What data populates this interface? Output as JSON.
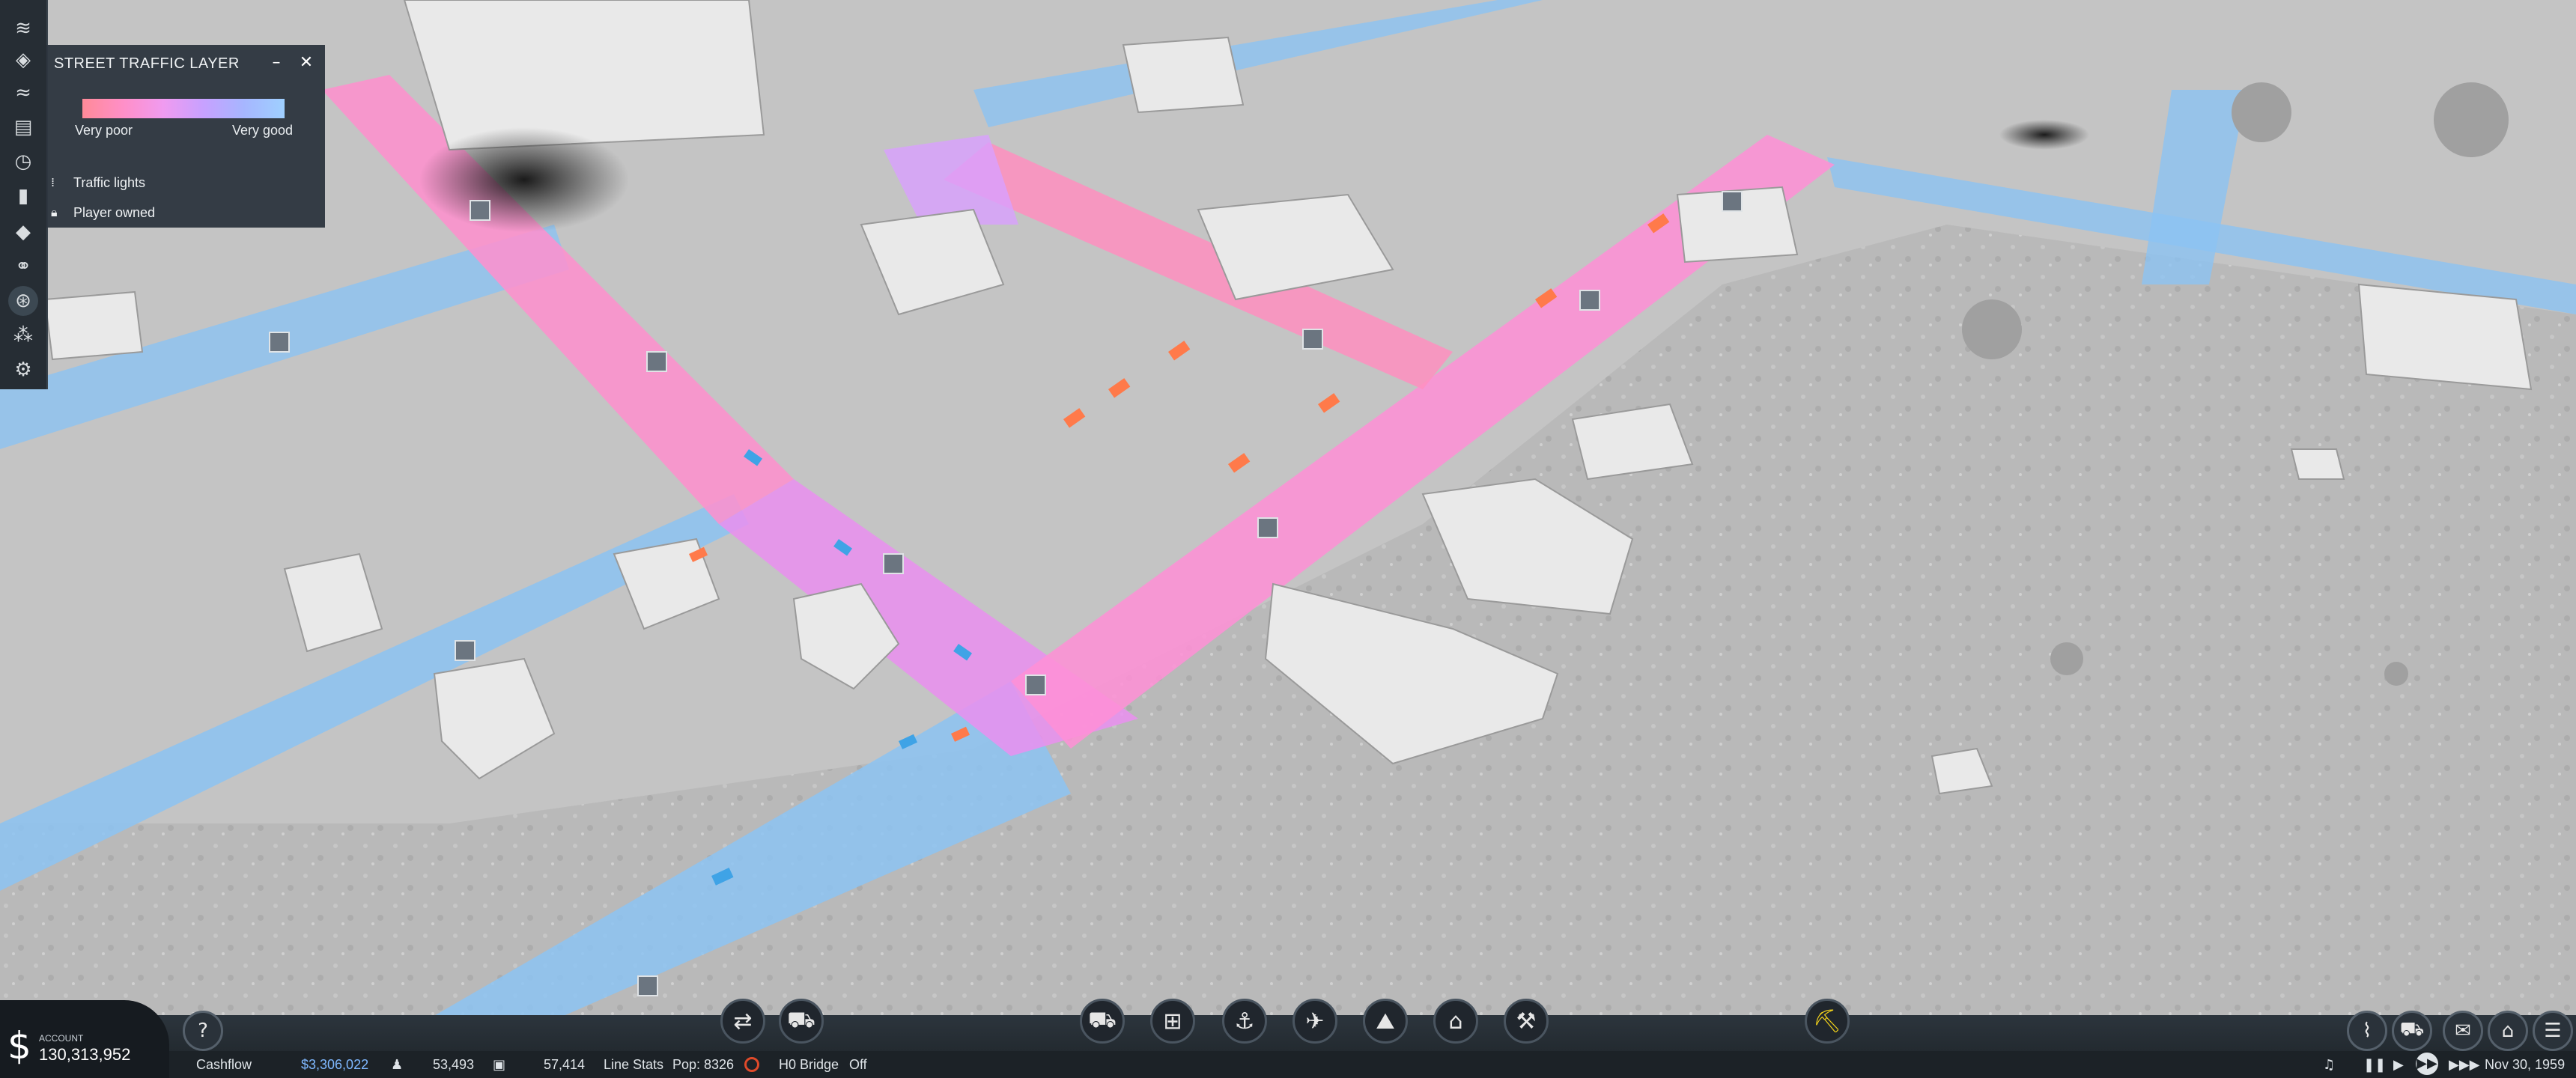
{
  "colors": {
    "very_poor": "#ff8a98",
    "very_good": "#9fd0ff",
    "panel_bg": "#2e363f",
    "cashflow_positive": "#7fb8ff"
  },
  "traffic_panel": {
    "title": "STREET TRAFFIC LAYER",
    "minimize_icon": "minimize-icon",
    "close_icon": "close-icon",
    "legend_low": "Very poor",
    "legend_high": "Very good",
    "rows": [
      {
        "label": "Traffic lights",
        "icon": "traffic-light-icon"
      },
      {
        "label": "Player owned",
        "icon": "lock-icon"
      }
    ]
  },
  "left_toolbar": {
    "icons": [
      "layers-icon",
      "terrain-icon",
      "water-icon",
      "newspaper-icon",
      "clock-icon",
      "stats-icon",
      "cube-icon",
      "network-icon",
      "traffic-layer-icon",
      "signal-icon",
      "settings-icon"
    ]
  },
  "account": {
    "label": "ACCOUNT",
    "value": "130,313,952",
    "currency_symbol": "$"
  },
  "status_bar": {
    "cashflow_label": "Cashflow",
    "cashflow_value": "$3,306,022",
    "people_value": "53,493",
    "cargo_value": "57,414",
    "line_stats": "Line Stats",
    "pop": "Pop: 8326",
    "bridge_label": "H0 Bridge",
    "bridge_state": "Off",
    "date": "Nov 30, 1959"
  },
  "bottom_tools": {
    "help": "?",
    "center_icons": [
      "shuffle-icon",
      "bus-depot-icon",
      "truck-station-icon",
      "train-station-icon",
      "harbor-icon",
      "airport-icon",
      "terraform-icon",
      "town-building-icon",
      "industry-icon"
    ],
    "bulldozer": "bulldozer-icon",
    "right_icons": [
      "graph-icon",
      "vehicle-list-icon",
      "message-icon",
      "city-list-icon",
      "menu-icon"
    ],
    "transport_controls": [
      "music-icon",
      "pause-icon",
      "play-icon",
      "fast-forward-icon",
      "faster-icon"
    ]
  }
}
